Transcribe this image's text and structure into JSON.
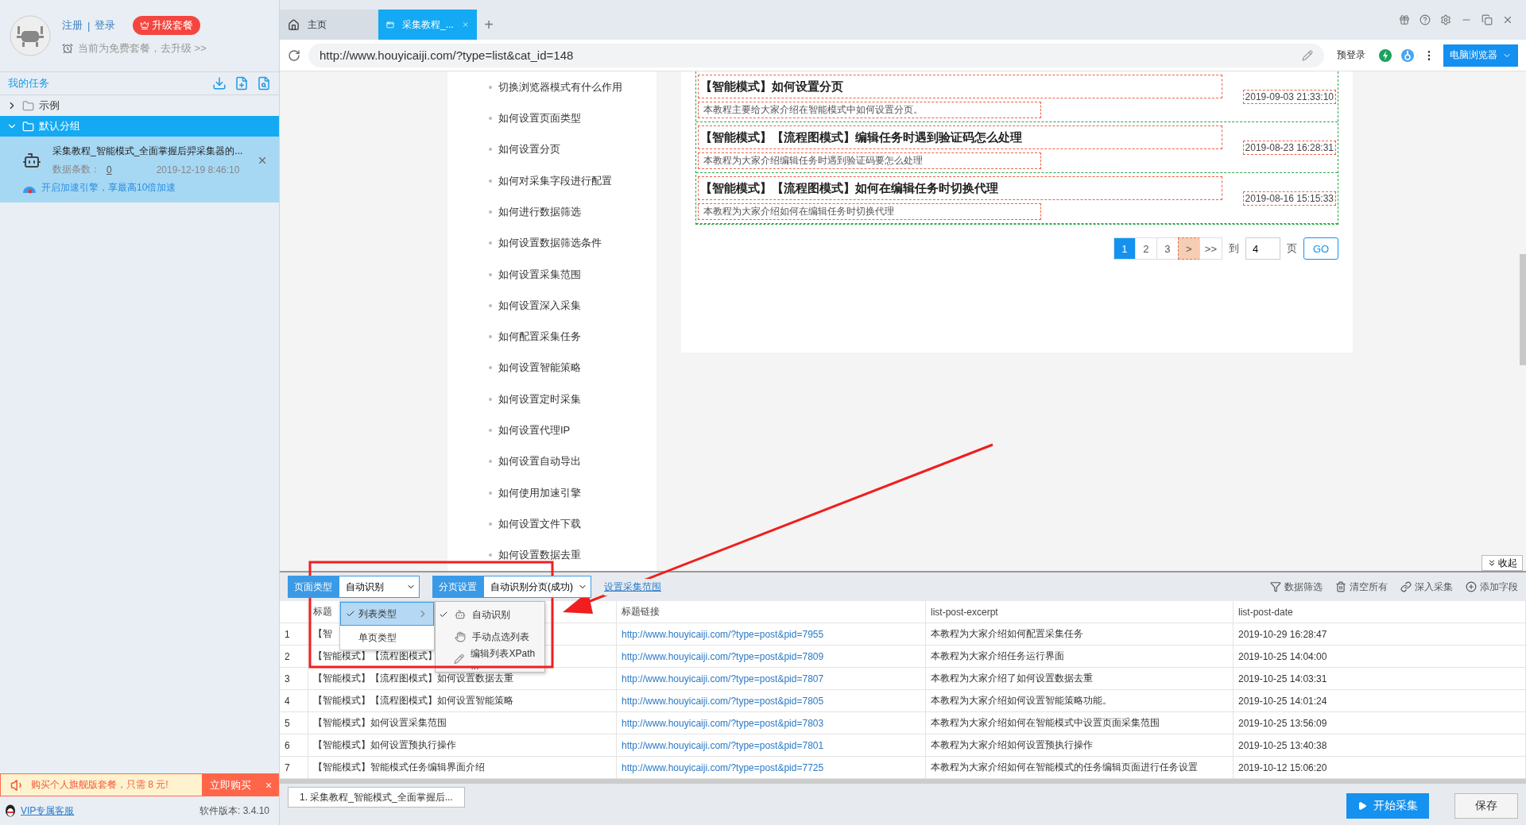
{
  "account": {
    "register": "注册",
    "separator": "|",
    "login": "登录",
    "upgrade": "升级套餐",
    "plan_notice": "当前为免费套餐，去升级 >>"
  },
  "tasks_panel": {
    "title": "我的任务",
    "groups": [
      {
        "label": "示例",
        "expanded": false,
        "selected": false
      },
      {
        "label": "默认分组",
        "expanded": true,
        "selected": true,
        "tasks": [
          {
            "title": "采集教程_智能模式_全面掌握后羿采集器的...",
            "count_label": "数据条数：",
            "count": "0",
            "date": "2019-12-19 8:46:10",
            "boost": "开启加速引擎，享最高10倍加速"
          }
        ]
      }
    ]
  },
  "promo": {
    "text": "购买个人旗舰版套餐，只需 8 元!",
    "button": "立即购买",
    "close": "×"
  },
  "sidebar_footer": {
    "support": "VIP专属客服",
    "version": "软件版本: 3.4.10"
  },
  "browser_tabs": [
    {
      "label": "主页",
      "kind": "home",
      "selected": false,
      "closable": false
    },
    {
      "label": "采集教程_...",
      "kind": "page",
      "selected": true,
      "closable": true
    }
  ],
  "new_tab": "+",
  "address_bar": {
    "url": "http://www.houyicaiji.com/?type=list&cat_id=148",
    "pre_login": "预登录",
    "mode_button": "电脑浏览器"
  },
  "web_page": {
    "category_links": [
      "切换浏览器模式有什么作用",
      "如何设置页面类型",
      "如何设置分页",
      "如何对采集字段进行配置",
      "如何进行数据筛选",
      "如何设置数据筛选条件",
      "如何设置采集范围",
      "如何设置深入采集",
      "如何配置采集任务",
      "如何设置智能策略",
      "如何设置定时采集",
      "如何设置代理IP",
      "如何设置自动导出",
      "如何使用加速引擎",
      "如何设置文件下载",
      "如何设置数据去重"
    ],
    "articles": [
      {
        "title": "【智能模式】如何设置分页",
        "excerpt": "本教程主要给大家介绍在智能模式中如何设置分页。",
        "date": "2019-09-03 21:33:10"
      },
      {
        "title": "【智能模式】【流程图模式】编辑任务时遇到验证码怎么处理",
        "excerpt": "本教程为大家介绍编辑任务时遇到验证码要怎么处理",
        "date": "2019-08-23 16:28:31"
      },
      {
        "title": "【智能模式】【流程图模式】如何在编辑任务时切换代理",
        "excerpt": "本教程为大家介绍如何在编辑任务时切换代理",
        "date": "2019-08-16 15:15:33"
      }
    ],
    "pagination": {
      "pages": [
        {
          "label": "1",
          "selected": true
        },
        {
          "label": "2",
          "selected": false
        },
        {
          "label": "3",
          "selected": false
        }
      ],
      "next": {
        "label": ">",
        "highlighted": true
      },
      "last": ">>",
      "goto_label": "到",
      "page_input": "4",
      "page_unit": "页",
      "go": "GO"
    }
  },
  "collapse_button": "收起",
  "extractor": {
    "page_type": {
      "label": "页面类型",
      "value": "自动识别"
    },
    "pagination": {
      "label": "分页设置",
      "value": "自动识别分页(成功)"
    },
    "range_link": "设置采集范围",
    "actions": [
      {
        "label": "数据筛选",
        "kind": "filter"
      },
      {
        "label": "清空所有",
        "kind": "trash"
      },
      {
        "label": "深入采集",
        "kind": "link"
      },
      {
        "label": "添加字段",
        "kind": "add"
      }
    ],
    "menu": [
      {
        "label": "列表类型",
        "selected": true,
        "submenu": true
      },
      {
        "label": "单页类型",
        "selected": false,
        "submenu": false
      }
    ],
    "submenu": [
      {
        "label": "自动识别",
        "kind": "robot",
        "checked": true
      },
      {
        "label": "手动点选列表",
        "kind": "hand",
        "checked": false
      },
      {
        "label": "编辑列表XPath ...",
        "kind": "pencil",
        "checked": false
      }
    ],
    "table": {
      "columns": [
        "标题",
        "标题链接",
        "list-post-excerpt",
        "list-post-date"
      ],
      "rows": [
        {
          "index": "1",
          "cells": [
            "【智",
            "http://www.houyicaiji.com/?type=post&pid=7955",
            "本教程为大家介绍如何配置采集任务",
            "2019-10-29 16:28:47"
          ]
        },
        {
          "index": "2",
          "cells": [
            "【智能模式】【流程图模式】",
            "http://www.houyicaiji.com/?type=post&pid=7809",
            "本教程为大家介绍任务运行界面",
            "2019-10-25 14:04:00"
          ]
        },
        {
          "index": "3",
          "cells": [
            "【智能模式】【流程图模式】如何设置数据去重",
            "http://www.houyicaiji.com/?type=post&pid=7807",
            "本教程为大家介绍了如何设置数据去重",
            "2019-10-25 14:03:31"
          ]
        },
        {
          "index": "4",
          "cells": [
            "【智能模式】【流程图模式】如何设置智能策略",
            "http://www.houyicaiji.com/?type=post&pid=7805",
            "本教程为大家介绍如何设置智能策略功能。",
            "2019-10-25 14:01:24"
          ]
        },
        {
          "index": "5",
          "cells": [
            "【智能模式】如何设置采集范围",
            "http://www.houyicaiji.com/?type=post&pid=7803",
            "本教程为大家介绍如何在智能模式中设置页面采集范围",
            "2019-10-25 13:56:09"
          ]
        },
        {
          "index": "6",
          "cells": [
            "【智能模式】如何设置预执行操作",
            "http://www.houyicaiji.com/?type=post&pid=7801",
            "本教程为大家介绍如何设置预执行操作",
            "2019-10-25 13:40:38"
          ]
        },
        {
          "index": "7",
          "cells": [
            "【智能模式】智能模式任务编辑界面介绍",
            "http://www.houyicaiji.com/?type=post&pid=7725",
            "本教程为大家介绍如何在智能模式的任务编辑页面进行任务设置",
            "2019-10-12 15:06:20"
          ]
        }
      ]
    }
  },
  "footer": {
    "task_tab": "1. 采集教程_智能模式_全面掌握后...",
    "start": "开始采集",
    "save": "保存"
  }
}
